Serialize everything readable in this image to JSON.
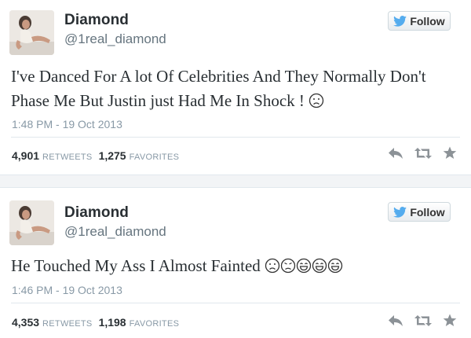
{
  "colors": {
    "text": "#292f33",
    "muted": "#66757f",
    "meta": "#8899a6",
    "bird": "#55acee",
    "action_icons": "#8c9297"
  },
  "tweets": [
    {
      "name": "Diamond",
      "handle": "@1real_diamond",
      "follow_label": "Follow",
      "text": "I've Danced For A lot Of Celebrities And They Normally Don't Phase Me But Justin just Had Me In Shock !",
      "emoji": [
        "frowning-face"
      ],
      "timestamp": "1:48 PM - 19 Oct 2013",
      "retweets": "4,901",
      "retweets_label": "RETWEETS",
      "favorites": "1,275",
      "favorites_label": "FAVORITES",
      "icons": [
        "reply-icon",
        "retweet-icon",
        "favorite-star-icon"
      ]
    },
    {
      "name": "Diamond",
      "handle": "@1real_diamond",
      "follow_label": "Follow",
      "text": "He Touched My Ass I Almost Fainted",
      "emoji": [
        "frowning-face",
        "worried-face",
        "laughing-face",
        "laughing-face",
        "laughing-face"
      ],
      "timestamp": "1:46 PM - 19 Oct 2013",
      "retweets": "4,353",
      "retweets_label": "RETWEETS",
      "favorites": "1,198",
      "favorites_label": "FAVORITES",
      "icons": [
        "reply-icon",
        "retweet-icon",
        "favorite-star-icon"
      ]
    }
  ]
}
